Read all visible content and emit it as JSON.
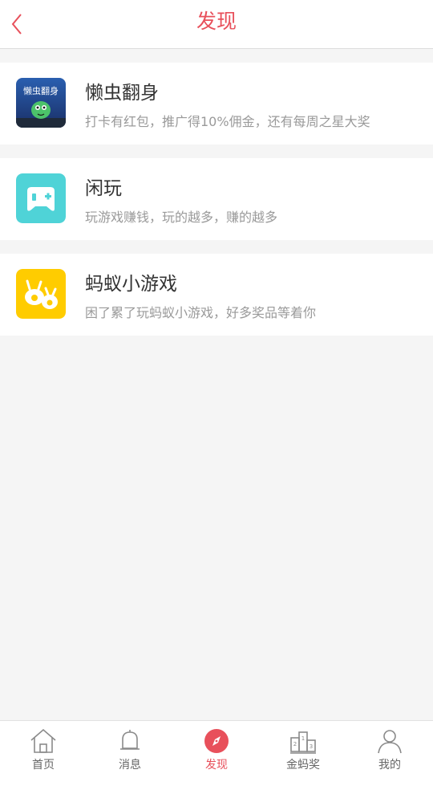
{
  "header": {
    "title": "发现"
  },
  "colors": {
    "accent": "#e8505b",
    "background": "#f5f5f5",
    "text_primary": "#333333",
    "text_secondary": "#9a9a9a"
  },
  "items": [
    {
      "name": "懒虫翻身",
      "desc": "打卡有红包，推广得10%佣金，还有每周之星大奖",
      "icon": "lazy-bug-app-icon",
      "icon_text": "懒虫翻身"
    },
    {
      "name": "闲玩",
      "desc": "玩游戏赚钱，玩的越多，赚的越多",
      "icon": "gamepad-app-icon"
    },
    {
      "name": "蚂蚁小游戏",
      "desc": "困了累了玩蚂蚁小游戏，好多奖品等着你",
      "icon": "ant-game-app-icon"
    }
  ],
  "tabbar": [
    {
      "label": "首页",
      "icon": "home-icon"
    },
    {
      "label": "消息",
      "icon": "bell-icon"
    },
    {
      "label": "发现",
      "icon": "compass-icon",
      "active": true
    },
    {
      "label": "金蚂奖",
      "icon": "podium-icon"
    },
    {
      "label": "我的",
      "icon": "user-icon"
    }
  ]
}
